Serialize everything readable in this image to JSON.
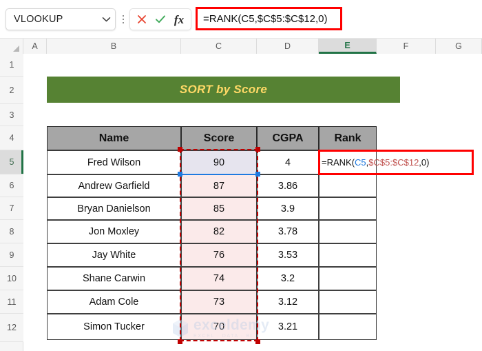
{
  "formula_bar": {
    "name_box_value": "VLOOKUP",
    "name_box_chevron_icon": "chevron-down-icon",
    "more_icon": "vertical-ellipsis-icon",
    "cancel_icon": "cancel-x-icon",
    "enter_icon": "enter-check-icon",
    "function_icon": "fx-insert-function-icon",
    "formula_text": "=RANK(C5,$C$5:$C$12,0)",
    "highlight_color": "#ff0000"
  },
  "sheet": {
    "column_headers": [
      "A",
      "B",
      "C",
      "D",
      "E",
      "F",
      "G"
    ],
    "selected_column": "E",
    "row_headers": [
      "1",
      "2",
      "3",
      "4",
      "5",
      "6",
      "7",
      "8",
      "9",
      "10",
      "11",
      "12"
    ],
    "selected_row": "5",
    "select_all_icon": "select-all-corner-icon",
    "accent_color": "#217346"
  },
  "banner": {
    "title": "SORT by Score",
    "fill_color": "#568233",
    "text_color": "#ffd966"
  },
  "table": {
    "headers": [
      "Name",
      "Score",
      "CGPA",
      "Rank"
    ],
    "header_fill": "#a6a6a6",
    "rows": [
      {
        "name": "Fred Wilson",
        "score": "90",
        "cgpa": "4",
        "rank": ""
      },
      {
        "name": "Andrew Garfield",
        "score": "87",
        "cgpa": "3.86",
        "rank": ""
      },
      {
        "name": "Bryan Danielson",
        "score": "85",
        "cgpa": "3.9",
        "rank": ""
      },
      {
        "name": "Jon Moxley",
        "score": "82",
        "cgpa": "3.78",
        "rank": ""
      },
      {
        "name": "Jay White",
        "score": "76",
        "cgpa": "3.53",
        "rank": ""
      },
      {
        "name": "Shane Carwin",
        "score": "74",
        "cgpa": "3.2",
        "rank": ""
      },
      {
        "name": "Adam Cole",
        "score": "73",
        "cgpa": "3.12",
        "rank": ""
      },
      {
        "name": "Simon Tucker",
        "score": "70",
        "cgpa": "3.21",
        "rank": ""
      }
    ]
  },
  "active_cell": {
    "address": "E5",
    "formula_parts": {
      "p1": "=RANK(",
      "ref1": "C5",
      "p2": ",",
      "ref2": "$C$5:$C$12",
      "p3": ",0)"
    },
    "ref1_color": "#1f7ae0",
    "ref2_color": "#c0504d",
    "selection_range": "C5:C12",
    "range_border_color": "#c00000",
    "active_ref_fill": "#e6e4ee",
    "range_fill": "#fbeaea"
  },
  "watermark": {
    "text": "exceldemy",
    "subtext": "EXCEL · DATA · BI"
  }
}
